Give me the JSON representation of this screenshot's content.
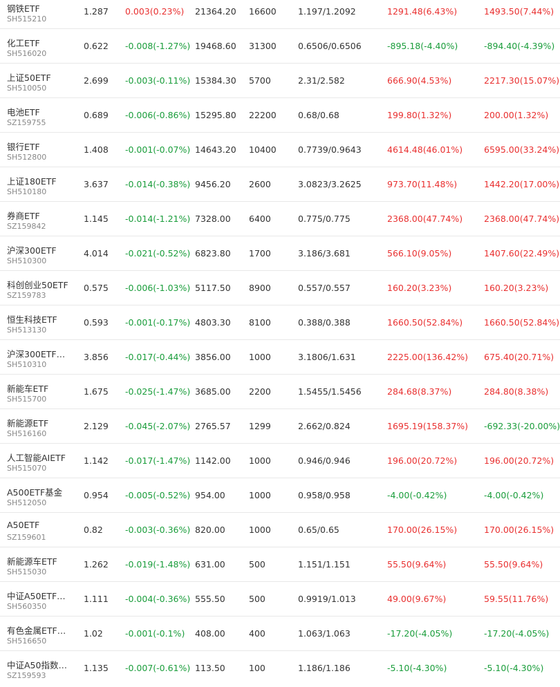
{
  "colors": {
    "up": "#e93030",
    "down": "#1a9d3b",
    "text": "#333333",
    "subtext": "#888888",
    "divider": "#e8e8e8"
  },
  "rows": [
    {
      "name": "钢铁ETF",
      "code": "SH515210",
      "price": "1.287",
      "change": "0.003(0.23%)",
      "change_dir": "up",
      "market_value": "21364.20",
      "quantity": "16600",
      "cost": "1.197/1.2092",
      "pnl_a": "1291.48(6.43%)",
      "pnl_a_dir": "up",
      "pnl_b": "1493.50(7.44%)",
      "pnl_b_dir": "up"
    },
    {
      "name": "化工ETF",
      "code": "SH516020",
      "price": "0.622",
      "change": "-0.008(-1.27%)",
      "change_dir": "down",
      "market_value": "19468.60",
      "quantity": "31300",
      "cost": "0.6506/0.6506",
      "pnl_a": "-895.18(-4.40%)",
      "pnl_a_dir": "down",
      "pnl_b": "-894.40(-4.39%)",
      "pnl_b_dir": "down"
    },
    {
      "name": "上证50ETF",
      "code": "SH510050",
      "price": "2.699",
      "change": "-0.003(-0.11%)",
      "change_dir": "down",
      "market_value": "15384.30",
      "quantity": "5700",
      "cost": "2.31/2.582",
      "pnl_a": "666.90(4.53%)",
      "pnl_a_dir": "up",
      "pnl_b": "2217.30(15.07%)",
      "pnl_b_dir": "up"
    },
    {
      "name": "电池ETF",
      "code": "SZ159755",
      "price": "0.689",
      "change": "-0.006(-0.86%)",
      "change_dir": "down",
      "market_value": "15295.80",
      "quantity": "22200",
      "cost": "0.68/0.68",
      "pnl_a": "199.80(1.32%)",
      "pnl_a_dir": "up",
      "pnl_b": "200.00(1.32%)",
      "pnl_b_dir": "up"
    },
    {
      "name": "银行ETF",
      "code": "SH512800",
      "price": "1.408",
      "change": "-0.001(-0.07%)",
      "change_dir": "down",
      "market_value": "14643.20",
      "quantity": "10400",
      "cost": "0.7739/0.9643",
      "pnl_a": "4614.48(46.01%)",
      "pnl_a_dir": "up",
      "pnl_b": "6595.00(33.24%)",
      "pnl_b_dir": "up"
    },
    {
      "name": "上证180ETF",
      "code": "SH510180",
      "price": "3.637",
      "change": "-0.014(-0.38%)",
      "change_dir": "down",
      "market_value": "9456.20",
      "quantity": "2600",
      "cost": "3.0823/3.2625",
      "pnl_a": "973.70(11.48%)",
      "pnl_a_dir": "up",
      "pnl_b": "1442.20(17.00%)",
      "pnl_b_dir": "up"
    },
    {
      "name": "券商ETF",
      "code": "SZ159842",
      "price": "1.145",
      "change": "-0.014(-1.21%)",
      "change_dir": "down",
      "market_value": "7328.00",
      "quantity": "6400",
      "cost": "0.775/0.775",
      "pnl_a": "2368.00(47.74%)",
      "pnl_a_dir": "up",
      "pnl_b": "2368.00(47.74%)",
      "pnl_b_dir": "up"
    },
    {
      "name": "沪深300ETF",
      "code": "SH510300",
      "price": "4.014",
      "change": "-0.021(-0.52%)",
      "change_dir": "down",
      "market_value": "6823.80",
      "quantity": "1700",
      "cost": "3.186/3.681",
      "pnl_a": "566.10(9.05%)",
      "pnl_a_dir": "up",
      "pnl_b": "1407.60(22.49%)",
      "pnl_b_dir": "up"
    },
    {
      "name": "科创创业50ETF",
      "code": "SZ159783",
      "price": "0.575",
      "change": "-0.006(-1.03%)",
      "change_dir": "down",
      "market_value": "5117.50",
      "quantity": "8900",
      "cost": "0.557/0.557",
      "pnl_a": "160.20(3.23%)",
      "pnl_a_dir": "up",
      "pnl_b": "160.20(3.23%)",
      "pnl_b_dir": "up"
    },
    {
      "name": "恒生科技ETF",
      "code": "SH513130",
      "price": "0.593",
      "change": "-0.001(-0.17%)",
      "change_dir": "down",
      "market_value": "4803.30",
      "quantity": "8100",
      "cost": "0.388/0.388",
      "pnl_a": "1660.50(52.84%)",
      "pnl_a_dir": "up",
      "pnl_b": "1660.50(52.84%)",
      "pnl_b_dir": "up"
    },
    {
      "name": "沪深300ETF…",
      "code": "SH510310",
      "price": "3.856",
      "change": "-0.017(-0.44%)",
      "change_dir": "down",
      "market_value": "3856.00",
      "quantity": "1000",
      "cost": "3.1806/1.631",
      "pnl_a": "2225.00(136.42%)",
      "pnl_a_dir": "up",
      "pnl_b": "675.40(20.71%)",
      "pnl_b_dir": "up"
    },
    {
      "name": "新能车ETF",
      "code": "SH515700",
      "price": "1.675",
      "change": "-0.025(-1.47%)",
      "change_dir": "down",
      "market_value": "3685.00",
      "quantity": "2200",
      "cost": "1.5455/1.5456",
      "pnl_a": "284.68(8.37%)",
      "pnl_a_dir": "up",
      "pnl_b": "284.80(8.38%)",
      "pnl_b_dir": "up"
    },
    {
      "name": "新能源ETF",
      "code": "SH516160",
      "price": "2.129",
      "change": "-0.045(-2.07%)",
      "change_dir": "down",
      "market_value": "2765.57",
      "quantity": "1299",
      "cost": "2.662/0.824",
      "pnl_a": "1695.19(158.37%)",
      "pnl_a_dir": "up",
      "pnl_b": "-692.33(-20.00%)",
      "pnl_b_dir": "down"
    },
    {
      "name": "人工智能AIETF",
      "code": "SH515070",
      "price": "1.142",
      "change": "-0.017(-1.47%)",
      "change_dir": "down",
      "market_value": "1142.00",
      "quantity": "1000",
      "cost": "0.946/0.946",
      "pnl_a": "196.00(20.72%)",
      "pnl_a_dir": "up",
      "pnl_b": "196.00(20.72%)",
      "pnl_b_dir": "up"
    },
    {
      "name": "A500ETF基金",
      "code": "SH512050",
      "price": "0.954",
      "change": "-0.005(-0.52%)",
      "change_dir": "down",
      "market_value": "954.00",
      "quantity": "1000",
      "cost": "0.958/0.958",
      "pnl_a": "-4.00(-0.42%)",
      "pnl_a_dir": "down",
      "pnl_b": "-4.00(-0.42%)",
      "pnl_b_dir": "down"
    },
    {
      "name": "A50ETF",
      "code": "SZ159601",
      "price": "0.82",
      "change": "-0.003(-0.36%)",
      "change_dir": "down",
      "market_value": "820.00",
      "quantity": "1000",
      "cost": "0.65/0.65",
      "pnl_a": "170.00(26.15%)",
      "pnl_a_dir": "up",
      "pnl_b": "170.00(26.15%)",
      "pnl_b_dir": "up"
    },
    {
      "name": "新能源车ETF",
      "code": "SH515030",
      "price": "1.262",
      "change": "-0.019(-1.48%)",
      "change_dir": "down",
      "market_value": "631.00",
      "quantity": "500",
      "cost": "1.151/1.151",
      "pnl_a": "55.50(9.64%)",
      "pnl_a_dir": "up",
      "pnl_b": "55.50(9.64%)",
      "pnl_b_dir": "up"
    },
    {
      "name": "中证A50ETF…",
      "code": "SH560350",
      "price": "1.111",
      "change": "-0.004(-0.36%)",
      "change_dir": "down",
      "market_value": "555.50",
      "quantity": "500",
      "cost": "0.9919/1.013",
      "pnl_a": "49.00(9.67%)",
      "pnl_a_dir": "up",
      "pnl_b": "59.55(11.76%)",
      "pnl_b_dir": "up"
    },
    {
      "name": "有色金属ETF…",
      "code": "SH516650",
      "price": "1.02",
      "change": "-0.001(-0.1%)",
      "change_dir": "down",
      "market_value": "408.00",
      "quantity": "400",
      "cost": "1.063/1.063",
      "pnl_a": "-17.20(-4.05%)",
      "pnl_a_dir": "down",
      "pnl_b": "-17.20(-4.05%)",
      "pnl_b_dir": "down"
    },
    {
      "name": "中证A50指数…",
      "code": "SZ159593",
      "price": "1.135",
      "change": "-0.007(-0.61%)",
      "change_dir": "down",
      "market_value": "113.50",
      "quantity": "100",
      "cost": "1.186/1.186",
      "pnl_a": "-5.10(-4.30%)",
      "pnl_a_dir": "down",
      "pnl_b": "-5.10(-4.30%)",
      "pnl_b_dir": "down"
    }
  ]
}
